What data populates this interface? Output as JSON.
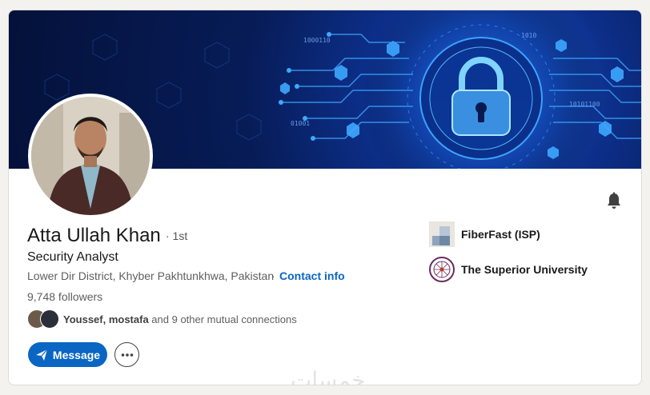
{
  "profile": {
    "name": "Atta Ullah Khan",
    "degree": "· 1st",
    "headline": "Security Analyst",
    "location": "Lower Dir District, Khyber Pakhtunkhwa, Pakistan",
    "location_separator": "·",
    "contact_info": "Contact info",
    "followers": "9,748 followers",
    "mutual_names": "Youssef, mostafa",
    "mutual_rest": " and 9 other mutual connections"
  },
  "banner": {
    "binary_1": "1000110",
    "binary_2": "01001",
    "binary_3": "1010",
    "binary_4": "10101100"
  },
  "actions": {
    "message_label": "Message",
    "message_icon": "send-icon",
    "more_icon": "more-icon",
    "bell_icon": "bell-icon"
  },
  "organizations": [
    {
      "name": "FiberFast (ISP)",
      "logo": "building-logo"
    },
    {
      "name": "The Superior University",
      "logo": "university-seal"
    }
  ],
  "watermark": "خمسات",
  "colors": {
    "accent": "#0a66c2",
    "banner_dark": "#04113a",
    "banner_glow": "#3ea8ff"
  }
}
